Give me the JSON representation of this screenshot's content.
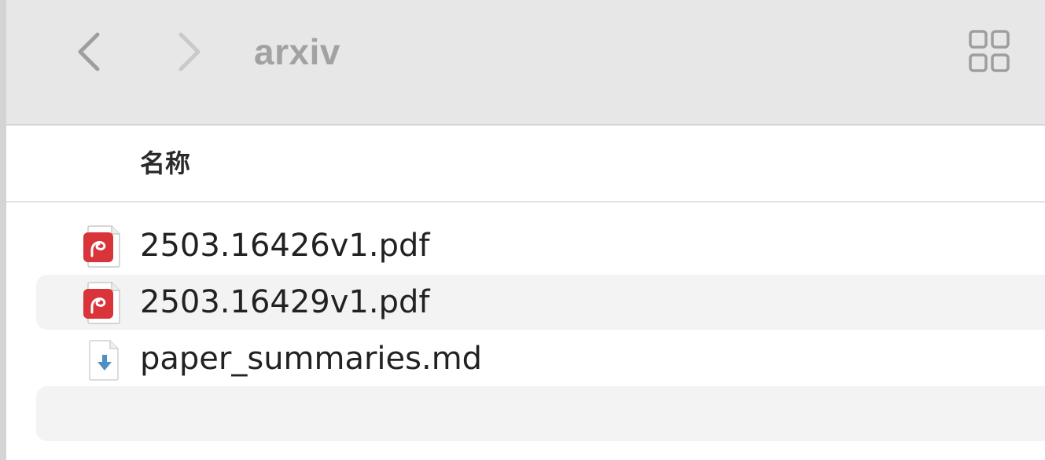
{
  "toolbar": {
    "title": "arxiv",
    "back_icon": "chevron-left-icon",
    "forward_icon": "chevron-right-icon",
    "view_icon": "grid-view-icon"
  },
  "list_header": {
    "name_column": "名称"
  },
  "files": [
    {
      "name": "2503.16426v1.pdf",
      "icon": "pdf-icon"
    },
    {
      "name": "2503.16429v1.pdf",
      "icon": "pdf-icon"
    },
    {
      "name": "paper_summaries.md",
      "icon": "markdown-file-icon"
    }
  ],
  "colors": {
    "toolbar_bg": "#e7e7e7",
    "alt_row_bg": "#f3f3f3",
    "pdf_red": "#d8343a",
    "md_arrow_blue": "#4f8fc4"
  }
}
